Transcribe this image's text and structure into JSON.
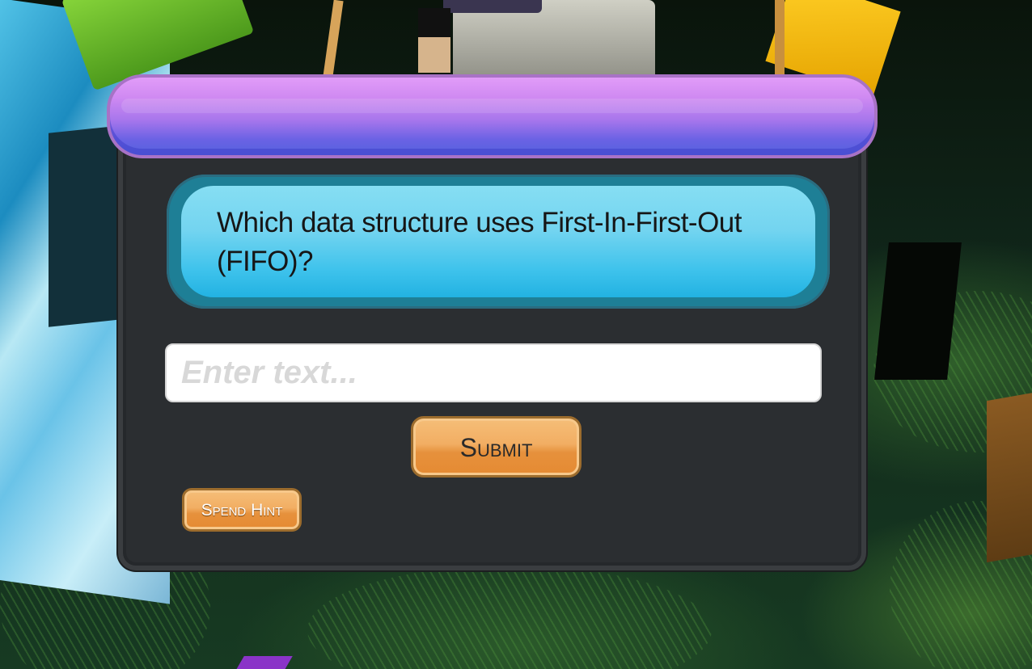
{
  "dialog": {
    "question": "Which data structure uses First-In-First-Out (FIFO)?",
    "answer_placeholder": "Enter text...",
    "answer_value": "",
    "submit_label": "Submit",
    "hint_label": "Spend Hint"
  },
  "colors": {
    "header_top": "#e19cf8",
    "header_bottom": "#5562de",
    "question_bg": "#3fc3ec",
    "panel_bg": "#2b2e31",
    "button_orange": "#f2ae63"
  }
}
